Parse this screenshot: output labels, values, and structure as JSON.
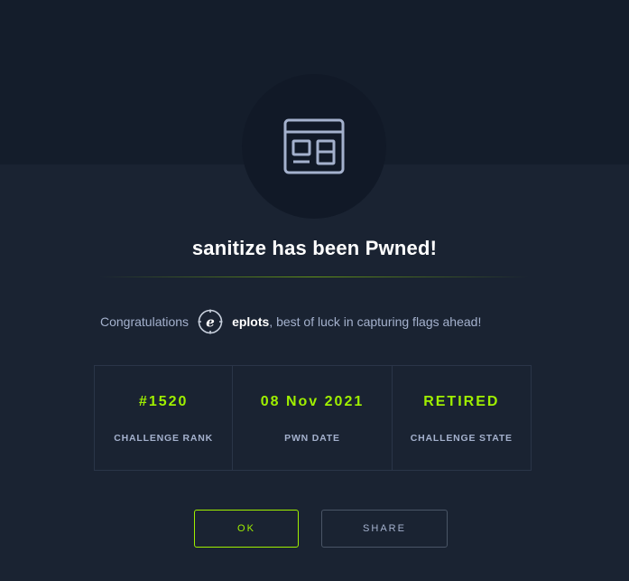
{
  "challenge": {
    "icon": "web-browser-icon",
    "title": "sanitize has been Pwned!"
  },
  "congrats": {
    "prefix": "Congratulations",
    "avatar_icon": "user-avatar-badge-icon",
    "username": "eplots",
    "suffix": ", best of luck in capturing flags ahead!"
  },
  "stats": [
    {
      "value": "#1520",
      "label": "CHALLENGE RANK"
    },
    {
      "value": "08 Nov 2021",
      "label": "PWN DATE"
    },
    {
      "value": "RETIRED",
      "label": "CHALLENGE STATE"
    }
  ],
  "buttons": {
    "ok_label": "OK",
    "share_label": "SHARE"
  },
  "colors": {
    "accent": "#9fef00",
    "background": "#1a2332",
    "muted_text": "#a4b1cd"
  }
}
